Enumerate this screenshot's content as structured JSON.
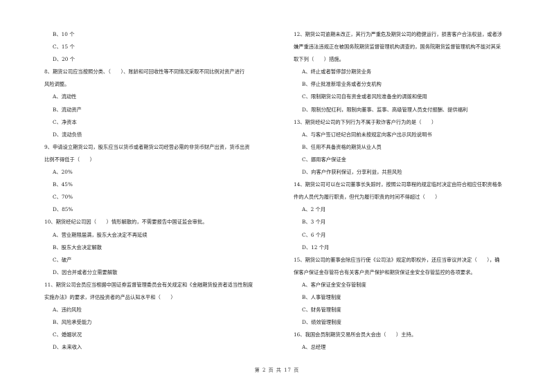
{
  "page": {
    "footer": "第 2 页 共 17 页"
  },
  "left_column": [
    {
      "type": "option",
      "text": "B、10 个"
    },
    {
      "type": "option",
      "text": "C、15 个"
    },
    {
      "type": "option",
      "text": "D、20 个"
    },
    {
      "type": "question",
      "text": "8、期货公司应当按照分类、（　　）、账龄和可回收性等不同情况采取不同比例对资产进行"
    },
    {
      "type": "question",
      "text": "风险调整。"
    },
    {
      "type": "option",
      "text": "A、流动性"
    },
    {
      "type": "option",
      "text": "B、流动资产"
    },
    {
      "type": "option",
      "text": "C、净资本"
    },
    {
      "type": "option",
      "text": "D、流动负债"
    },
    {
      "type": "question",
      "text": "9、申请设立期货公司，股东应当以货币或者期货公司经营必需的非货币财产出资，货币出资"
    },
    {
      "type": "question",
      "text": "比例不得低于（　　）"
    },
    {
      "type": "option",
      "text": "A、20%"
    },
    {
      "type": "option",
      "text": "B、45%"
    },
    {
      "type": "option",
      "text": "C、70%"
    },
    {
      "type": "option",
      "text": "D、85%"
    },
    {
      "type": "question",
      "text": "10、期货经纪公司因（　　）情形解散的，不需要报告中国证监会审批。"
    },
    {
      "type": "option",
      "text": "A、营业期限届满，股东大会决定不再延续"
    },
    {
      "type": "option",
      "text": "B、股东大会决定解散"
    },
    {
      "type": "option",
      "text": "C、破产"
    },
    {
      "type": "option",
      "text": "D、因合并或者分立需要解散"
    },
    {
      "type": "question",
      "text": "11、期货公司会员应当根据中国证券监督管理委员会有关规定和《金融期货投资者适当性制度"
    },
    {
      "type": "question",
      "text": "实施办法》的要求，评估投资者的产品认知水平和（　　）"
    },
    {
      "type": "option",
      "text": "A、违约风险"
    },
    {
      "type": "option",
      "text": "B、风险承受能力"
    },
    {
      "type": "option",
      "text": "C、婚姻状况"
    },
    {
      "type": "option",
      "text": "D、未来收入"
    }
  ],
  "right_column": [
    {
      "type": "question",
      "text": "12、期货公司逾期未改正，其行为严重危及期货公司的稳健运行，损害客户合法权益，或者涉"
    },
    {
      "type": "question",
      "text": "嫌严重违法违规正在被国务院期货监督管理机构调查的，国务院期货监督管理机构不能对其采"
    },
    {
      "type": "question",
      "text": "取下列（　　）措施。"
    },
    {
      "type": "option",
      "text": "A、终止或者暂停部分期货业务"
    },
    {
      "type": "option",
      "text": "B、停止批准新增业务或者分支机构"
    },
    {
      "type": "option",
      "text": "C、限制期货公司自有资金或者风险准备金的调拨和使用"
    },
    {
      "type": "option",
      "text": "D、限制分配红利，限制向董事、监事、高级管理人员支付报酬、提供福利"
    },
    {
      "type": "question",
      "text": "13、期货经纪公司的下列行为不属于欺诈客户行为的是（　　）"
    },
    {
      "type": "option",
      "text": "A、与客户签订经纪合同前未按规定向客户出示风险说明书"
    },
    {
      "type": "option",
      "text": "B、任用不具备资格的期货从业人员"
    },
    {
      "type": "option",
      "text": "C、挪用客户保证金"
    },
    {
      "type": "option",
      "text": "D、向客户作获利保证，分享利益，共担风险"
    },
    {
      "type": "question",
      "text": "14、期货公司可以在公司董事长失踪时，按照公司章程的规定临时决定由符合相应任职资格条"
    },
    {
      "type": "question",
      "text": "件的人员代为履行职责，但代为履行职责的时间不得超过（　　）"
    },
    {
      "type": "option",
      "text": "A、2 个月"
    },
    {
      "type": "option",
      "text": "B、3 个月"
    },
    {
      "type": "option",
      "text": "C、6 个月"
    },
    {
      "type": "option",
      "text": "D、12 个月"
    },
    {
      "type": "question",
      "text": "15、期货公司的董事会除应当行使《公司法》规定的职权外，还应当审议并决定（　　），确"
    },
    {
      "type": "question",
      "text": "保客户保证金存管符合有关客户资产保护和期货保证金安全存管监控的各项要求。"
    },
    {
      "type": "option",
      "text": "A、客户保证金安全存管制度"
    },
    {
      "type": "option",
      "text": "B、人事管理制度"
    },
    {
      "type": "option",
      "text": "C、财务管理制度"
    },
    {
      "type": "option",
      "text": "D、绩效管理制度"
    },
    {
      "type": "question",
      "text": "16、我国会员制期货交易所会员大会由（　　）主持。"
    },
    {
      "type": "option",
      "text": "A、总经理"
    }
  ]
}
